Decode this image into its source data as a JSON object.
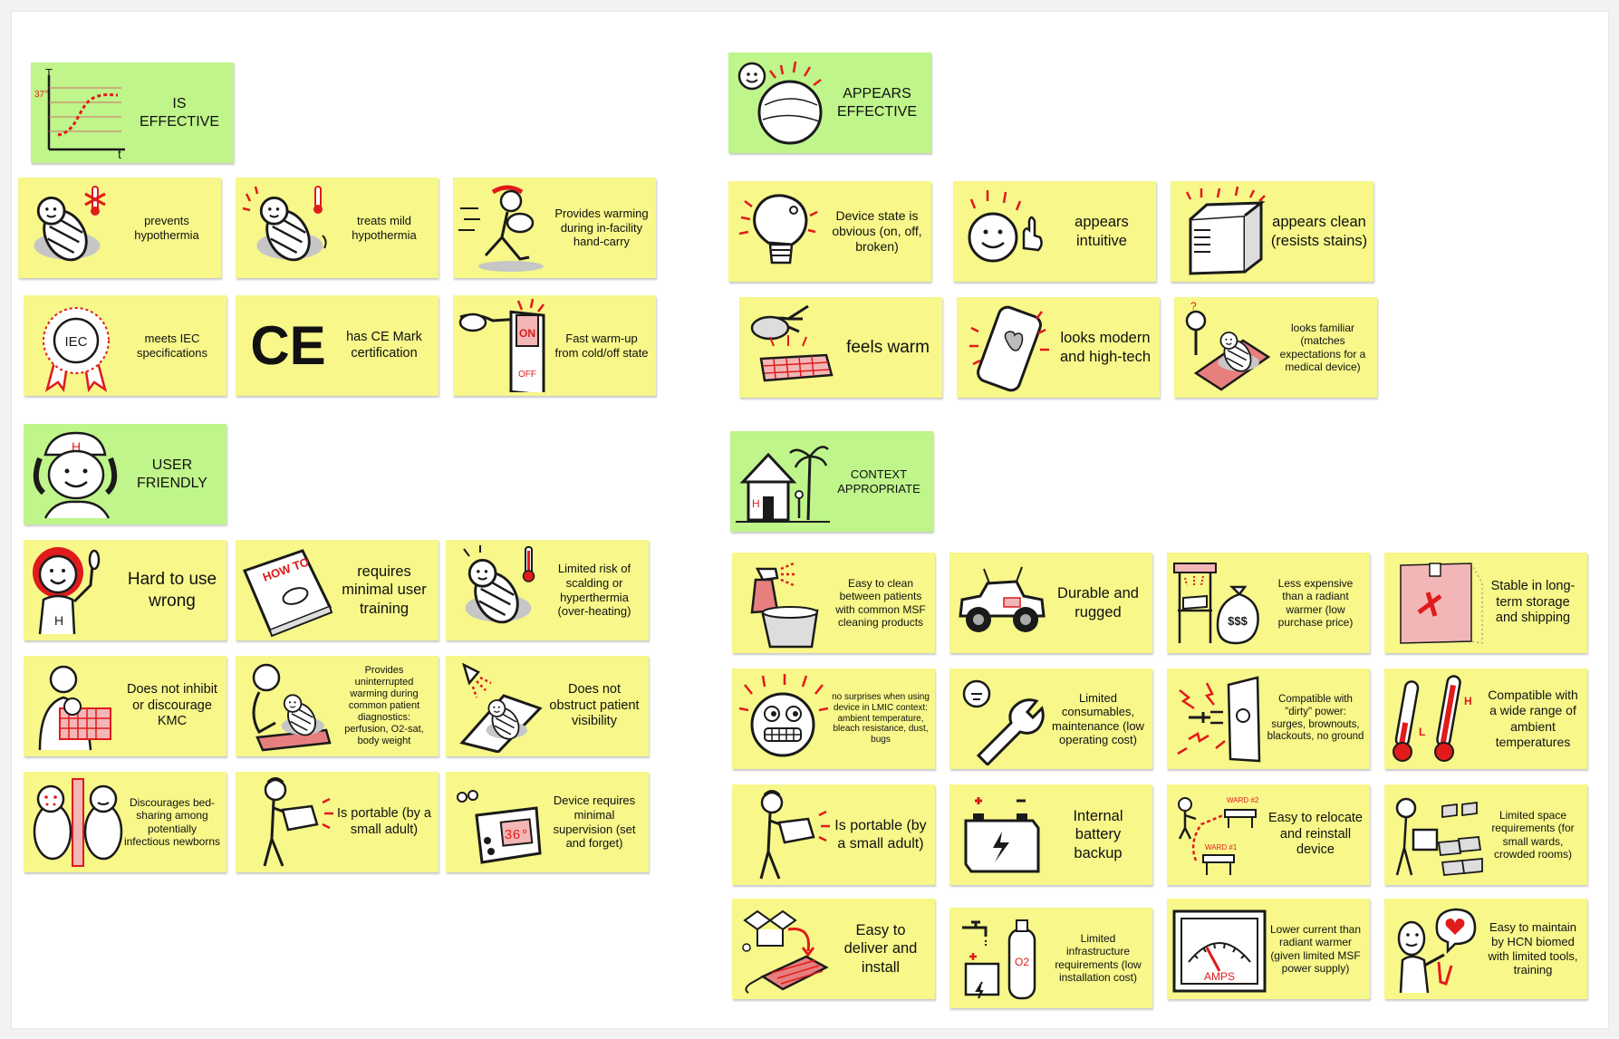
{
  "sections": {
    "is_effective": {
      "header": "IS\nEFFECTIVE",
      "chart_axis_t": "T",
      "chart_temp": "37°",
      "chart_axis_time": "t",
      "cards": [
        "prevents hypothermia",
        "treats mild hypothermia",
        "Provides warming during in-facility hand-carry",
        "meets IEC specifications",
        "has CE Mark certification",
        "Fast warm-up from cold/off state"
      ]
    },
    "appears_effective": {
      "header": "APPEARS\nEFFECTIVE",
      "cards": [
        "Device state is obvious (on, off, broken)",
        "appears intuitive",
        "appears clean (resists stains)",
        "feels warm",
        "looks modern and high-tech",
        "looks familiar (matches expectations for a medical device)"
      ]
    },
    "user_friendly": {
      "header": "USER\nFRIENDLY",
      "cards": [
        "Hard to use wrong",
        "requires minimal user training",
        "Limited risk of scalding or hyperthermia (over-heating)",
        "Does not inhibit or discourage KMC",
        "Provides uninterrupted warming during common patient diagnostics: perfusion, O2-sat, body weight",
        "Does not obstruct patient visibility",
        "Discourages bed-sharing among potentially infectious newborns",
        "Is portable (by a small adult)",
        "Device requires minimal supervision (set and forget)"
      ]
    },
    "context_appropriate": {
      "header": "CONTEXT\nAPPROPRIATE",
      "cards": [
        "Easy to clean between patients with common MSF cleaning products",
        "Durable and rugged",
        "Less expensive than a radiant warmer (low purchase price)",
        "Stable in long-term storage and shipping",
        "no surprises when using device in LMIC context: ambient temperature, bleach resistance, dust, bugs",
        "Limited consumables, maintenance (low operating cost)",
        "Compatible with \"dirty\" power: surges, brownouts, blackouts, no ground",
        "Compatible with a wide range of ambient temperatures",
        "Is portable (by a small adult)",
        "Internal battery backup",
        "Easy to relocate and reinstall device",
        "Limited space requirements (for small wards, crowded rooms)",
        "Easy to deliver and install",
        "Limited infrastructure requirements (low installation cost)",
        "Lower current than radiant warmer (given limited MSF power supply)",
        "Easy to maintain by HCN biomed with limited tools, training"
      ]
    }
  },
  "icon_text": {
    "iec": "IEC",
    "ce": "CE",
    "how_to": "HOW TO",
    "on": "ON",
    "off": "OFF",
    "h": "H",
    "temp_36": "36°",
    "l": "L",
    "dollars": "$$$",
    "ward2": "WARD #2",
    "ward1": "WARD #1",
    "o2": "O2",
    "amps": "AMPS"
  },
  "colors": {
    "card": "#f7f78a",
    "header": "#bff58a",
    "red": "#e01b1b",
    "ink": "#1a1a1a",
    "shade": "#b8b8b8"
  }
}
